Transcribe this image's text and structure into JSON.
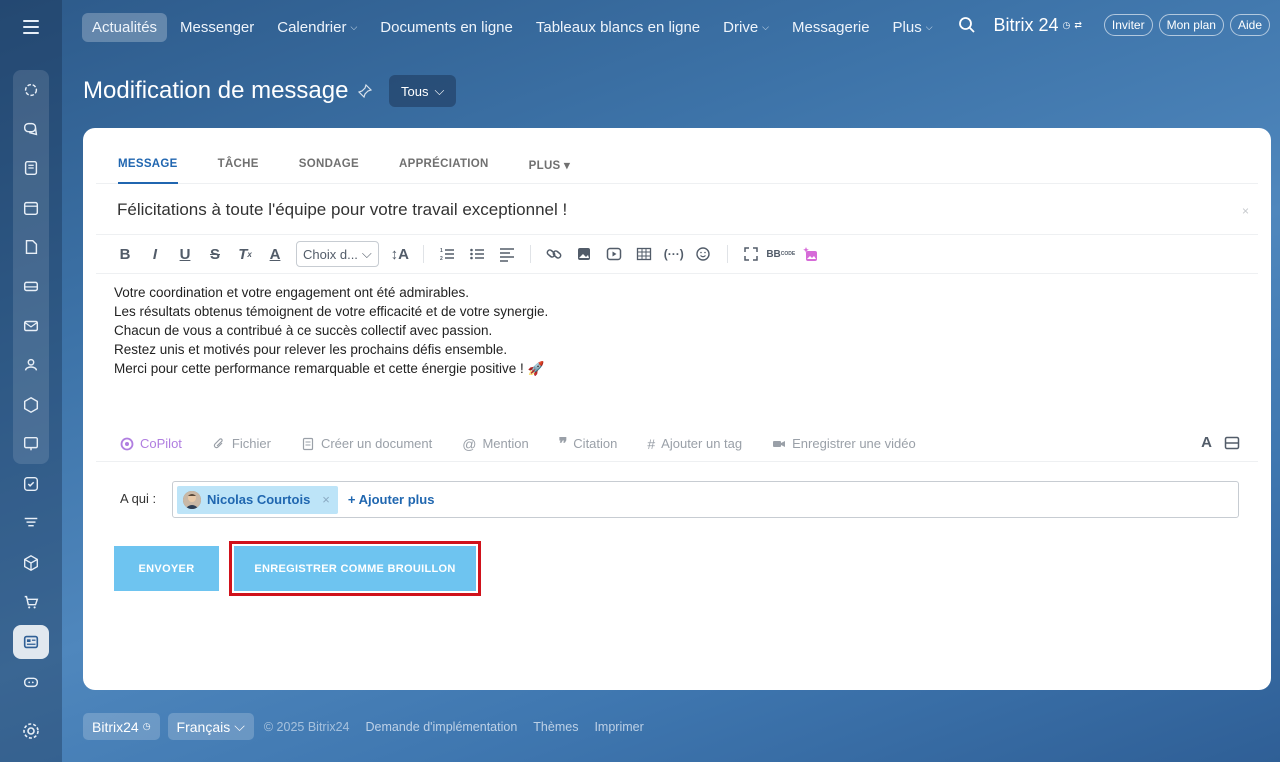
{
  "topnav": {
    "items": [
      {
        "label": "Actualités",
        "active": true
      },
      {
        "label": "Messenger"
      },
      {
        "label": "Calendrier",
        "caret": "⌵"
      },
      {
        "label": "Documents en ligne"
      },
      {
        "label": "Tableaux blancs en ligne"
      },
      {
        "label": "Drive",
        "caret": "⌵"
      },
      {
        "label": "Messagerie"
      },
      {
        "label": "Plus",
        "caret": "⌵"
      }
    ],
    "brand": "Bitrix 24",
    "invite_label": "Inviter",
    "plan_label": "Mon plan",
    "help_label": "Aide"
  },
  "page": {
    "title": "Modification de message",
    "filter_label": "Tous"
  },
  "tabs": [
    "MESSAGE",
    "TÂCHE",
    "SONDAGE",
    "APPRÉCIATION",
    "PLUS ▾"
  ],
  "editor": {
    "subject": "Félicitations à toute l'équipe pour votre travail exceptionnel !",
    "subject_close": "×",
    "font_select": "Choix d...",
    "lines": [
      "Votre coordination et votre engagement ont été admirables.",
      "Les résultats obtenus témoignent de votre efficacité et de votre synergie.",
      "Chacun de vous a contribué à ce succès collectif avec passion.",
      "Restez unis et motivés pour relever les prochains défis ensemble.",
      "Merci pour cette performance remarquable et cette énergie positive ! 🚀"
    ]
  },
  "actions": {
    "copilot": "CoPilot",
    "file": "Fichier",
    "create_doc": "Créer un document",
    "mention": "Mention",
    "quote": "Citation",
    "tag": "Ajouter un tag",
    "video": "Enregistrer une vidéo",
    "font_toggle": "A"
  },
  "recipients": {
    "label": "A qui :",
    "items": [
      {
        "name": "Nicolas Courtois"
      }
    ],
    "add_more": "+ Ajouter plus"
  },
  "buttons": {
    "send": "ENVOYER",
    "draft": "ENREGISTRER COMME BROUILLON"
  },
  "footer": {
    "brand": "Bitrix24",
    "language": "Français",
    "copyright": "© 2025 Bitrix24",
    "links": [
      "Demande d'implémentation",
      "Thèmes",
      "Imprimer"
    ]
  },
  "colors": {
    "accent": "#2066b0",
    "button": "#6ec4f0",
    "highlight": "#d0121b"
  }
}
